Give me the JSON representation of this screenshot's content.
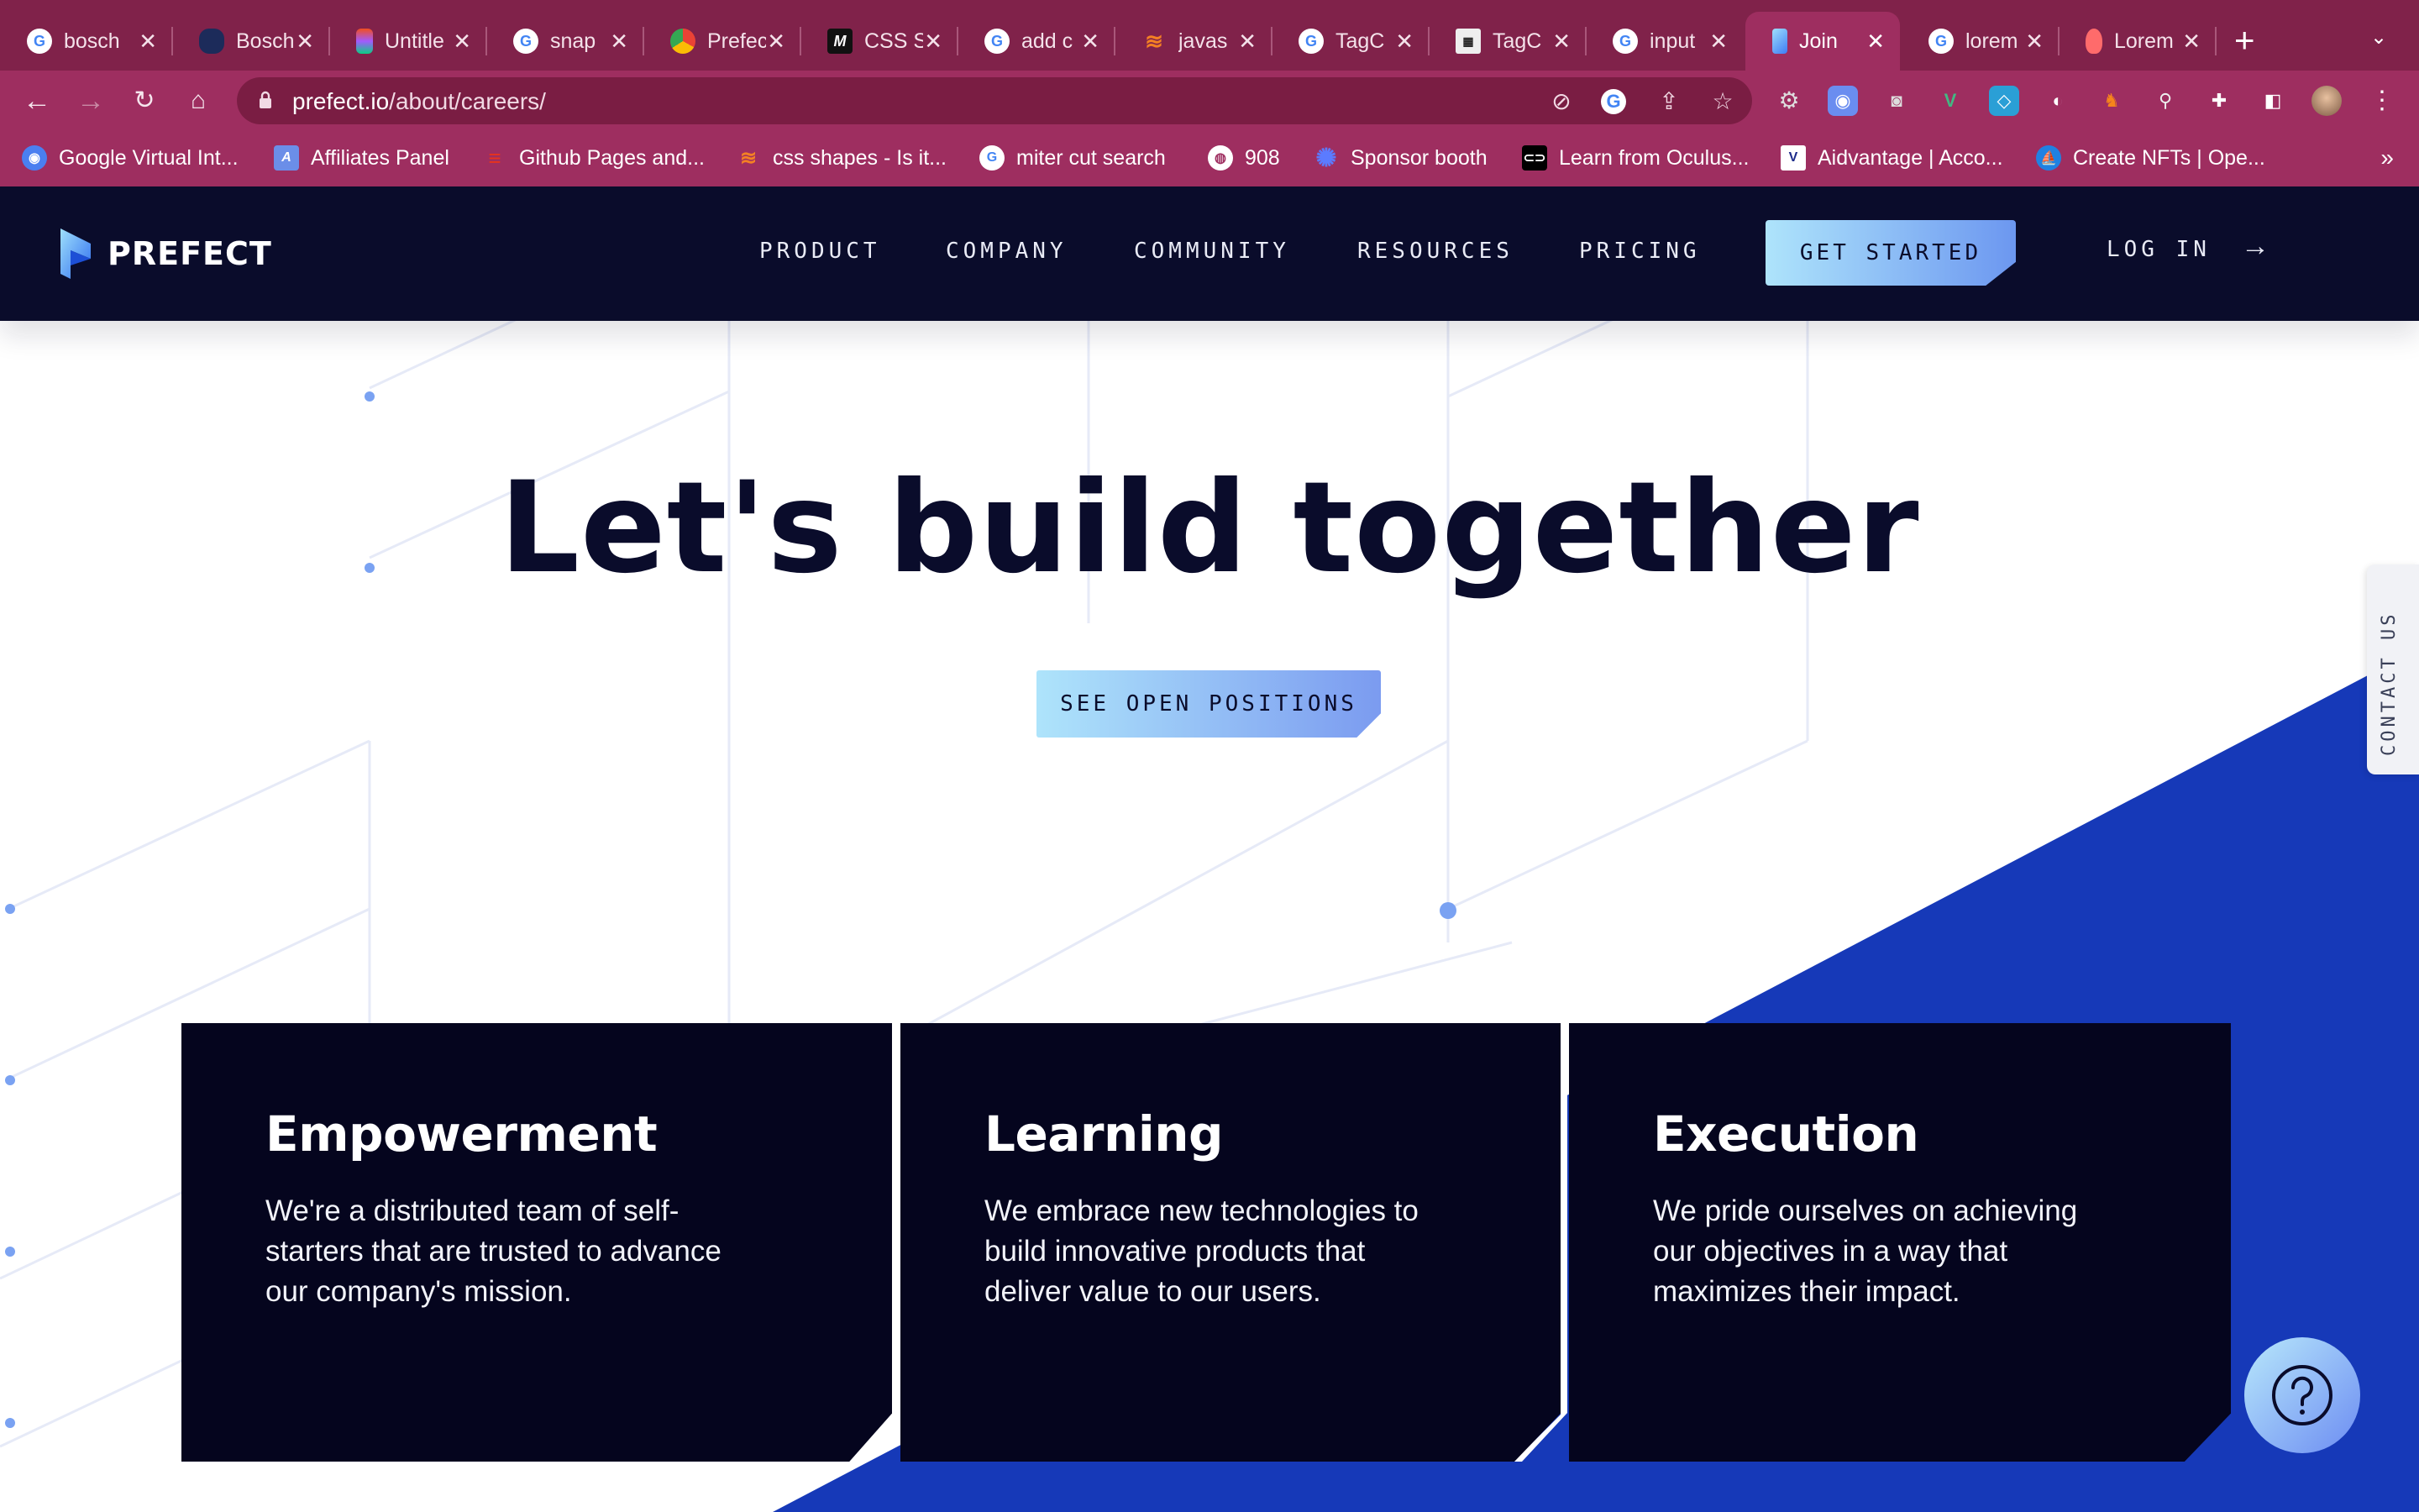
{
  "browser": {
    "tabs": [
      {
        "title": "bosch",
        "favicon": "google-icon",
        "color": "#ffffff"
      },
      {
        "title": "Bosch",
        "favicon": "bosch-icon",
        "color": "#1c2b5a"
      },
      {
        "title": "Untitled",
        "favicon": "figma-icon",
        "color": "#f24e1e"
      },
      {
        "title": "snap",
        "favicon": "google-icon",
        "color": "#ffffff"
      },
      {
        "title": "Prefect",
        "favicon": "chrome-logo-icon",
        "color": "#ffffff"
      },
      {
        "title": "CSS Shapes",
        "favicon": "m-logo-icon",
        "color": "#111111"
      },
      {
        "title": "add c",
        "favicon": "google-icon",
        "color": "#ffffff"
      },
      {
        "title": "javas",
        "favicon": "stackoverflow-icon",
        "color": "#f48024"
      },
      {
        "title": "TagC",
        "favicon": "google-icon",
        "color": "#ffffff"
      },
      {
        "title": "TagC",
        "favicon": "tagc-icon",
        "color": "#ffffff"
      },
      {
        "title": "input",
        "favicon": "google-icon",
        "color": "#ffffff"
      },
      {
        "title": "Join",
        "favicon": "prefect-icon",
        "color": "#3e7bf6",
        "active": true
      },
      {
        "title": "lorem",
        "favicon": "google-icon",
        "color": "#ffffff"
      },
      {
        "title": "Lorem",
        "favicon": "pin-icon",
        "color": "#ff6b6b"
      }
    ],
    "new_tab_icon": "plus-icon",
    "url_domain": "prefect.io",
    "url_path": "/about/careers/",
    "bookmarks": [
      {
        "label": "Google Virtual Int...",
        "icon": "lightbulb-icon"
      },
      {
        "label": "Affiliates Panel",
        "icon": "affiliate-icon"
      },
      {
        "label": "Github Pages and...",
        "icon": "zig-icon"
      },
      {
        "label": "css shapes - Is it...",
        "icon": "stackoverflow-icon"
      },
      {
        "label": "miter cut search",
        "icon": "google-icon"
      },
      {
        "label": "908",
        "icon": "globe-icon"
      },
      {
        "label": "Sponsor booth",
        "icon": "sponsor-icon"
      },
      {
        "label": "Learn from Oculus...",
        "icon": "oculus-icon"
      },
      {
        "label": "Aidvantage | Acco...",
        "icon": "aidvantage-icon"
      },
      {
        "label": "Create NFTs | Ope...",
        "icon": "opensea-icon"
      }
    ],
    "bookmarks_more": "»"
  },
  "site": {
    "logo_text": "PREFECT",
    "nav": [
      "PRODUCT",
      "COMPANY",
      "COMMUNITY",
      "RESOURCES",
      "PRICING"
    ],
    "get_started": "GET STARTED",
    "login": "LOG IN",
    "login_arrow": "→",
    "hero_title": "Let's build together",
    "cta": "SEE OPEN POSITIONS",
    "contact_tab": "CONTACT US",
    "cards": [
      {
        "title": "Empowerment",
        "body": "We're a distributed team of self-starters that are trusted to advance our company's mission."
      },
      {
        "title": "Learning",
        "body": "We embrace new technologies to build innovative products that deliver value to our users."
      },
      {
        "title": "Execution",
        "body": "We pride ourselves on achieving our objectives in a way that maximizes their impact."
      }
    ],
    "colors": {
      "header_bg": "#0a0c2b",
      "accent_blue": "#1639b8",
      "card_bg": "#05051e"
    }
  }
}
